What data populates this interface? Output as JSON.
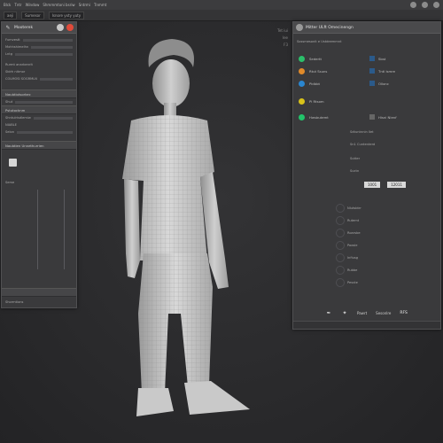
{
  "titlebar": {
    "menu": [
      "Blck",
      "Tntr",
      "Window",
      "Shmmmtoni bsriw",
      "Sntrmi",
      "Tnmmt"
    ]
  },
  "toolbar2": {
    "fields": [
      "aeji",
      "Sumesor",
      "Isnore yxty yuty"
    ]
  },
  "left_panel": {
    "title": "Mooterek",
    "rows": [
      "Fumvestt",
      "Mxhhshimelhn",
      "Lntg"
    ],
    "sub_rows": [
      "Rurmt anarbenrit",
      "Sblrh nitmor",
      "COLMOSI SOGRMLN"
    ],
    "sections": [
      "Naubtiotsorkec",
      "Pstutocknm",
      "Naubtien Unnethurrien"
    ],
    "detail_rows": [
      "Shut",
      "Shntulrisdlemiw",
      "NIABLE",
      "Selon"
    ],
    "bottom_rows": [
      "Seme",
      "Shormtions"
    ]
  },
  "right_panel": {
    "title": "Mitter ULft  Omecinengn",
    "header_row": "Sossmesonit e  Ustdeemmnt",
    "attrs": [
      {
        "label": "Sedertt",
        "color": "#2bbf6a"
      },
      {
        "label": "Rtut Ssuns",
        "color": "#e08a2a"
      },
      {
        "label": "Pidbbt",
        "color": "#2a86d0"
      },
      {
        "label": "Pi  Rtsom",
        "color": "#d8c21a"
      },
      {
        "label": "Hwsbutemt",
        "color": "#22c36a"
      }
    ],
    "right_attrs": [
      "Sbst",
      "Tntl  lsmre",
      "Ollonc",
      "Hisni Nlenf"
    ],
    "detail_rows": [
      "Sdtuntnnin Ilet",
      "Sn1  Cuntenterd",
      "Sutter",
      "Suctn"
    ],
    "lower_rows": [
      "Nlutsbtrr",
      "Rutemt",
      "Roarsbe",
      "Poosle",
      "Infiusg",
      "Rubbe",
      "Pesvte"
    ],
    "footer": [
      "Pawrt",
      "Sesonlre",
      "RFS"
    ],
    "values": [
      "1001",
      "12011"
    ]
  },
  "viewport": {
    "tags": [
      "Tet iui",
      "Iee",
      "F3"
    ]
  }
}
